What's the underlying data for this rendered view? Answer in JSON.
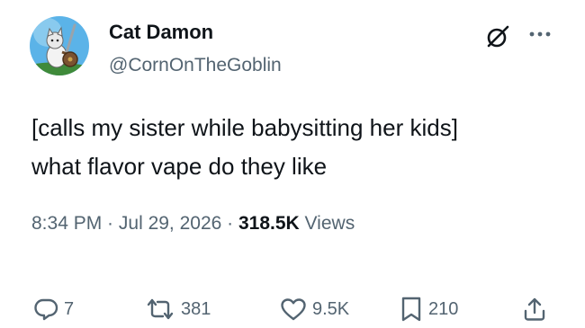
{
  "author": {
    "name": "Cat Damon",
    "handle": "@CornOnTheGoblin"
  },
  "tweet": {
    "lines": [
      "[calls my sister while babysitting her kids]",
      "what flavor vape do they like"
    ]
  },
  "meta": {
    "time": "8:34 PM",
    "separator1": " · ",
    "date": "Jul 29, 2026",
    "separator2": " · ",
    "views_count": "318.5K",
    "views_label": " Views"
  },
  "actions": {
    "replies": "7",
    "reposts": "381",
    "likes": "9.5K",
    "bookmarks": "210"
  },
  "icons": {
    "reply": "reply-icon",
    "repost": "repost-icon",
    "like": "heart-icon",
    "bookmark": "bookmark-icon",
    "share": "share-icon",
    "grok": "grok-icon",
    "more": "more-icon"
  },
  "colors": {
    "text": "#0f1419",
    "secondary": "#536471",
    "avatar_bg": "#5bb3e8"
  }
}
